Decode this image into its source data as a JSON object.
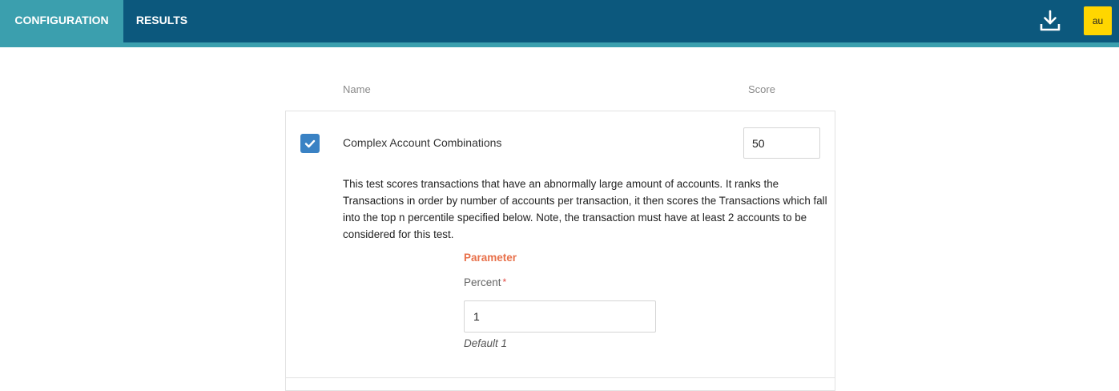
{
  "nav": {
    "tabs": [
      {
        "label": "CONFIGURATION",
        "active": true
      },
      {
        "label": "RESULTS",
        "active": false
      }
    ],
    "download_icon": "download-icon",
    "avatar_initials": "au"
  },
  "colors": {
    "nav_background": "#0c587d",
    "nav_accent": "#3b9fae",
    "checkbox": "#3a82c4",
    "parameter_heading": "#e8704a",
    "avatar_background": "#ffd600"
  },
  "table": {
    "headers": {
      "name": "Name",
      "score": "Score"
    }
  },
  "test": {
    "enabled": true,
    "name": "Complex Account Combinations",
    "score": "50",
    "description": "This test scores transactions that have an abnormally large amount of accounts. It ranks the Transactions in order by number of accounts per transaction, it then scores the Transactions which fall into the top n percentile specified below. Note, the transaction must have at least 2 accounts to be considered for this test.",
    "parameter": {
      "heading": "Parameter",
      "label": "Percent",
      "required_marker": "*",
      "value": "1",
      "hint": "Default 1"
    }
  }
}
